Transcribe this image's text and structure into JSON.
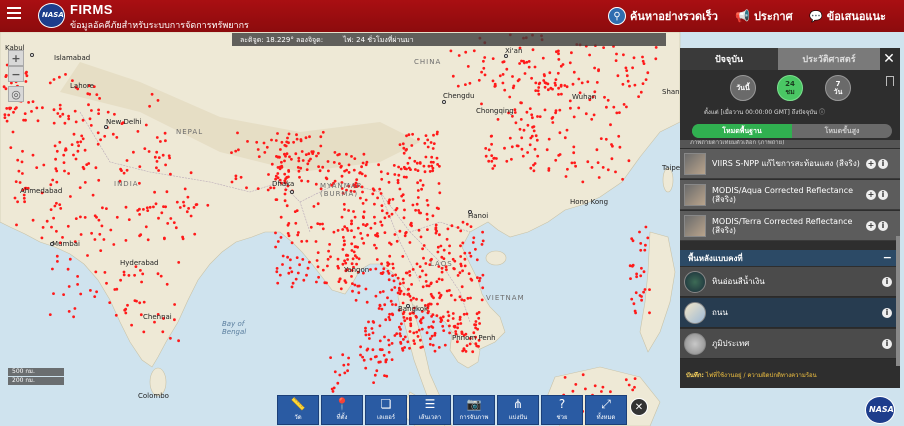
{
  "header": {
    "brand_title": "FIRMS",
    "brand_subtitle": "ข้อมูลอัคคีภัยสำหรับระบบการจัดการทรัพยากร",
    "logo_text": "NASA",
    "search_label": "ค้นหาอย่างรวดเร็ว",
    "alerts_label": "ประกาศ",
    "feedback_label": "ข้อเสนอแนะ"
  },
  "info_strip": {
    "latitude": "ละติจูด: 18.229° ลองจิจูด:",
    "fires": "ไฟ: 24 ชั่วโมงที่ผ่านมา"
  },
  "scale": {
    "top": "500 กม.",
    "bottom": "200 กม."
  },
  "map_labels": {
    "kabul": "Kabul",
    "islamabad": "Islamabad",
    "lahore": "Lahore",
    "new_delhi": "New Delhi",
    "nepal": "NEPAL",
    "india": "INDIA",
    "ahmedabad": "Ahmedabad",
    "mumbai": "Mumbai",
    "hyderabad": "Hyderabad",
    "chennai": "Chennai",
    "colombo": "Colombo",
    "bay_of_bengal": "Bay of\nBengal",
    "dhaka": "Dhaka",
    "myanmar": "MYANMAR\n(BURMA)",
    "yangon": "Yangon",
    "bangkok": "Bangkok",
    "phnom_penh": "Phnom Penh",
    "hanoi": "Hanoi",
    "laos": "LAOS",
    "china": "CHINA",
    "xian": "Xi'an",
    "chengdu": "Chengdu",
    "chongqing": "Chongqing",
    "wuhan": "Wuhan",
    "shanghai": "Shangh",
    "hong_kong": "Hong Kong",
    "taipei": "Taipe",
    "vietnam": "VIETNAM"
  },
  "panel": {
    "tab_current": "ปัจจุบัน",
    "tab_history": "ประวัติศาสตร์",
    "range": {
      "today_label": "วันนี้",
      "h24_num": "24",
      "h24_unit": "ชม",
      "d7_num": "7",
      "d7_unit": "วัน"
    },
    "range_note": "ตั้งแต่ [เมื่อวาน 00:00:00 GMT] ถึงปัจจุบัน ⓘ",
    "toggle_basic": "โหมดพื้นฐาน",
    "toggle_advanced": "โหมดขั้นสูง",
    "layers_cut_label": "ภาพถ่ายดาวเทียมตัวเลือก (ภาพถ่าย)",
    "layers": [
      {
        "name": "VIIRS S-NPP แก้ไขการสะท้อนแสง (สีจริง)"
      },
      {
        "name": "MODIS/Aqua Corrected Reflectance (สีจริง)"
      },
      {
        "name": "MODIS/Terra Corrected Reflectance (สีจริง)"
      }
    ],
    "bg_header": "พื้นหลังแบบคงที่",
    "bg_layers": [
      {
        "name": "หินอ่อนสีน้ำเงิน"
      },
      {
        "name": "ถนน"
      },
      {
        "name": "ภูมิประเทศ"
      }
    ],
    "footer_bold": "บันทึก:",
    "footer_text": "ไฟที่ใช้งานอยู่ / ความผิดปกติทางความร้อน"
  },
  "toolbar": {
    "measure": "วัด",
    "location": "ที่ตั้ง",
    "layers": "เลเยอร์",
    "time": "เส้นเวลา",
    "capture": "การจับภาพ",
    "share": "แบ่งปัน",
    "help": "ช่วย",
    "fullscreen": "ทั้งหมด"
  },
  "colors": {
    "header": "#a90f12",
    "fire": "#ff1a1a",
    "panel": "#2e2e2e",
    "toolbar": "#2a5ba3"
  }
}
